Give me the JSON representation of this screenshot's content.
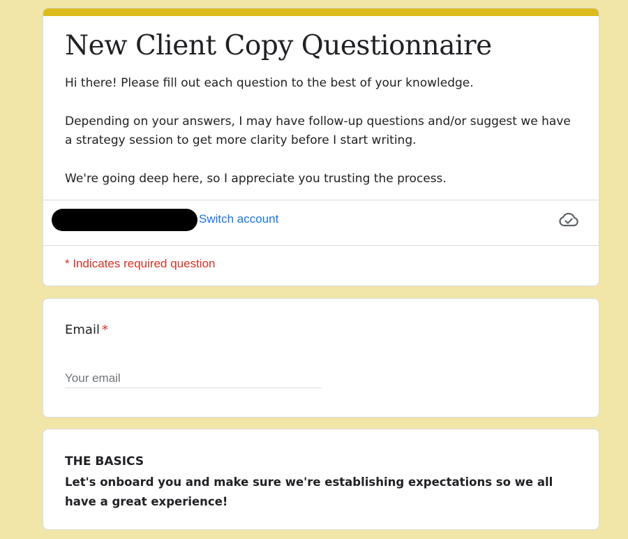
{
  "form": {
    "title": "New Client Copy Questionnaire",
    "description": [
      "Hi there! Please fill out each question to the best of your knowledge.",
      "Depending on your answers, I may have follow-up questions and/or suggest we have a strategy session to get more clarity before I start writing.",
      "We're going deep here, so I appreciate you trusting the process."
    ],
    "accent_color": "#dcbb1d",
    "background_color": "#f1e5a7"
  },
  "account": {
    "switch_label": "Switch account",
    "status_icon": "cloud-check-icon"
  },
  "required_note": "* Indicates required question",
  "email_question": {
    "label": "Email",
    "required_marker": "*",
    "placeholder": "Your email",
    "value": ""
  },
  "section": {
    "title": "THE BASICS",
    "description": "Let's onboard you and make sure we're establishing expectations so we all have a great experience!"
  }
}
